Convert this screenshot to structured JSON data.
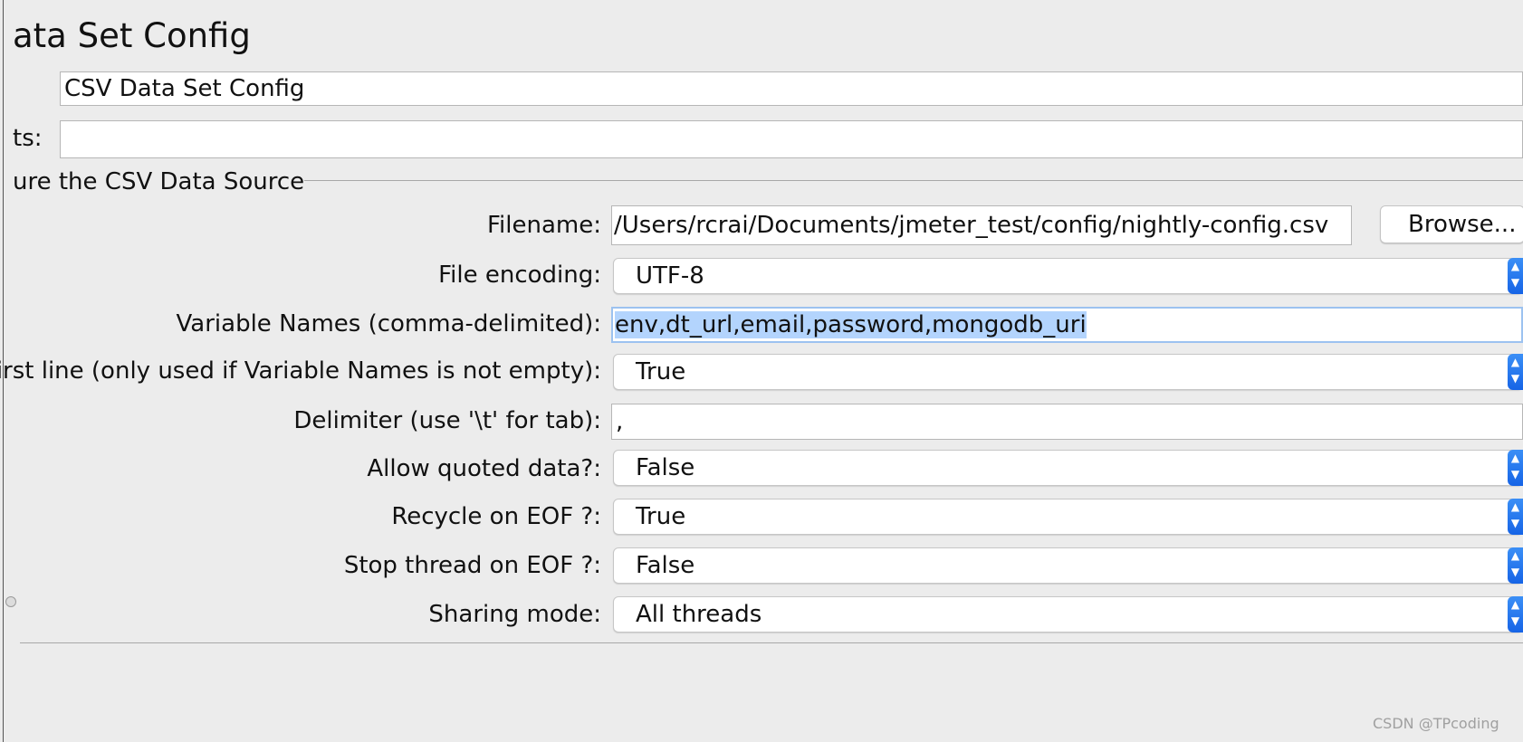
{
  "panel_title": "ata Set Config",
  "name_field": {
    "value": "CSV Data Set Config"
  },
  "comments": {
    "label": "ts:",
    "value": ""
  },
  "group": {
    "title": "ure the CSV Data Source",
    "filename": {
      "label": "Filename:",
      "value": "/Users/rcrai/Documents/jmeter_test/config/nightly-config.csv",
      "browse_label": "Browse..."
    },
    "file_encoding": {
      "label": "File encoding:",
      "value": "UTF-8"
    },
    "variable_names": {
      "label": "Variable Names (comma-delimited):",
      "value": "env,dt_url,email,password,mongodb_uri"
    },
    "ignore_first_line": {
      "label": "irst line (only used if Variable Names is not empty):",
      "value": "True"
    },
    "delimiter": {
      "label": "Delimiter (use '\\t' for tab):",
      "value": ","
    },
    "allow_quoted": {
      "label": "Allow quoted data?:",
      "value": "False"
    },
    "recycle_eof": {
      "label": "Recycle on EOF ?:",
      "value": "True"
    },
    "stop_thread_eof": {
      "label": "Stop thread on EOF ?:",
      "value": "False"
    },
    "sharing_mode": {
      "label": "Sharing mode:",
      "value": "All threads"
    }
  },
  "watermark": "CSDN @TPcoding",
  "icons": {
    "combo_arrow": "chevron-updown-icon",
    "splitter": "splitter-handle-icon"
  },
  "colors": {
    "accent": "#1a6cf0",
    "selection": "#b3d4fd",
    "background": "#ececec"
  }
}
